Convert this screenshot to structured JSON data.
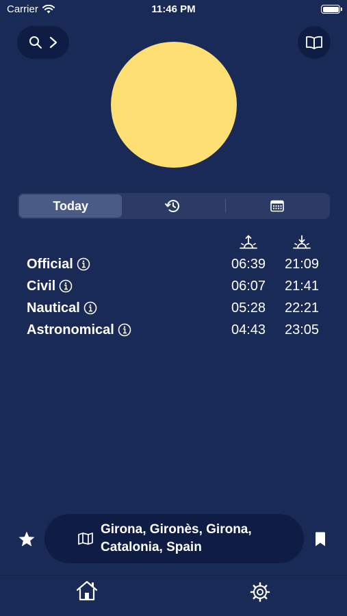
{
  "status_bar": {
    "carrier": "Carrier",
    "time": "11:46 PM",
    "battery_level": 1.0
  },
  "toolbar": {
    "search_icon": "search-icon",
    "chevron_icon": "chevron-right-icon",
    "book_icon": "book-open-icon"
  },
  "sun": {
    "color": "#fedf73"
  },
  "segments": {
    "today_label": "Today",
    "history_icon": "history-clock-icon",
    "calendar_icon": "calendar-icon",
    "selected": "Today"
  },
  "times": {
    "header_icons": [
      "sunrise-icon",
      "sunset-icon"
    ],
    "rows": [
      {
        "label": "Official",
        "sunrise": "06:39",
        "sunset": "21:09"
      },
      {
        "label": "Civil",
        "sunrise": "06:07",
        "sunset": "21:41"
      },
      {
        "label": "Nautical",
        "sunrise": "05:28",
        "sunset": "22:21"
      },
      {
        "label": "Astronomical",
        "sunrise": "04:43",
        "sunset": "23:05"
      }
    ]
  },
  "location": {
    "line1": "Girona, Gironès, Girona,",
    "line2": "Catalonia, Spain"
  },
  "colors": {
    "background": "#1a2a57",
    "pill": "#0f1d44",
    "segment_bg": "#2b3b66",
    "segment_active": "#4a5b86",
    "sun": "#fedf73"
  },
  "tab_bar": {
    "icons": [
      "home-icon",
      "gear-icon"
    ]
  }
}
